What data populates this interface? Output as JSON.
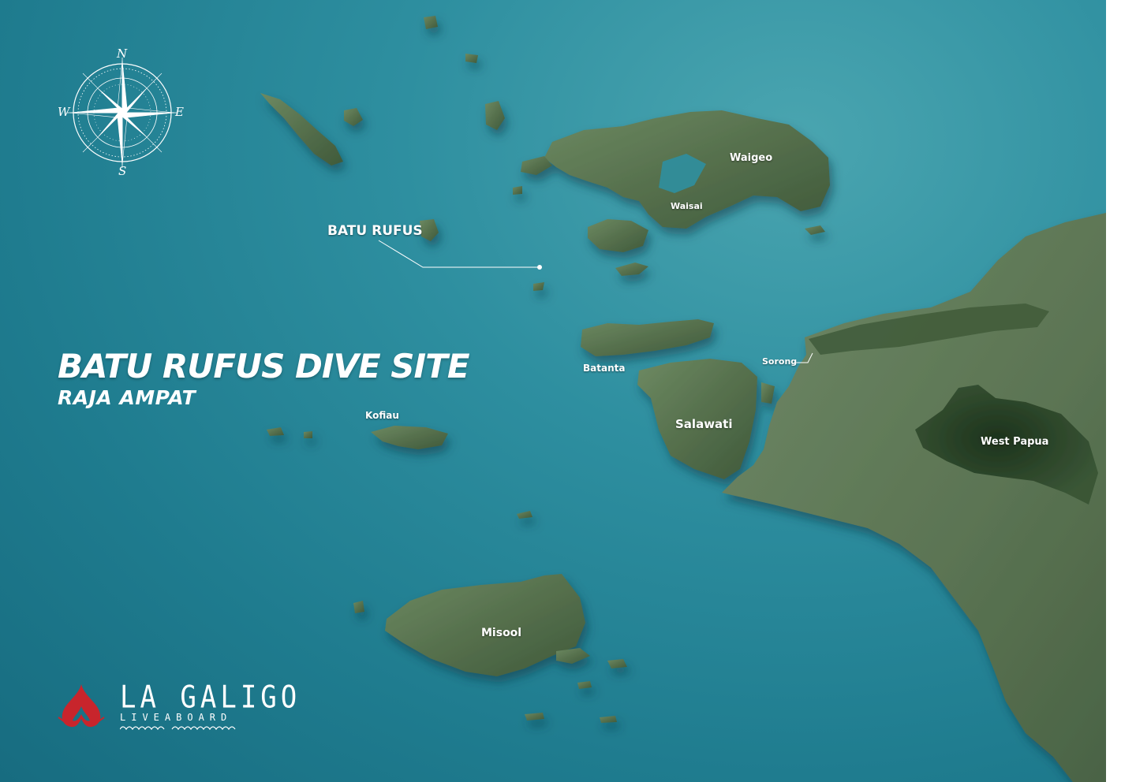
{
  "map": {
    "title": "BATU RUFUS DIVE SITE",
    "subtitle": "RAJA AMPAT",
    "site_label": "BATU RUFUS",
    "places": {
      "waigeo": "Waigeo",
      "waisai": "Waisai",
      "batanta": "Batanta",
      "sorong": "Sorong",
      "salawati": "Salawati",
      "west_papua": "West Papua",
      "kofiau": "Kofiau",
      "misool": "Misool"
    }
  },
  "compass": {
    "n": "N",
    "s": "S",
    "e": "E",
    "w": "W"
  },
  "brand": {
    "name": "LA GALIGO",
    "tagline": "LIVEABOARD",
    "logo_color": "#c8252c"
  },
  "colors": {
    "sea": "#2e8fa0",
    "land": "#56704d",
    "land_dark": "#2f4a2c"
  }
}
